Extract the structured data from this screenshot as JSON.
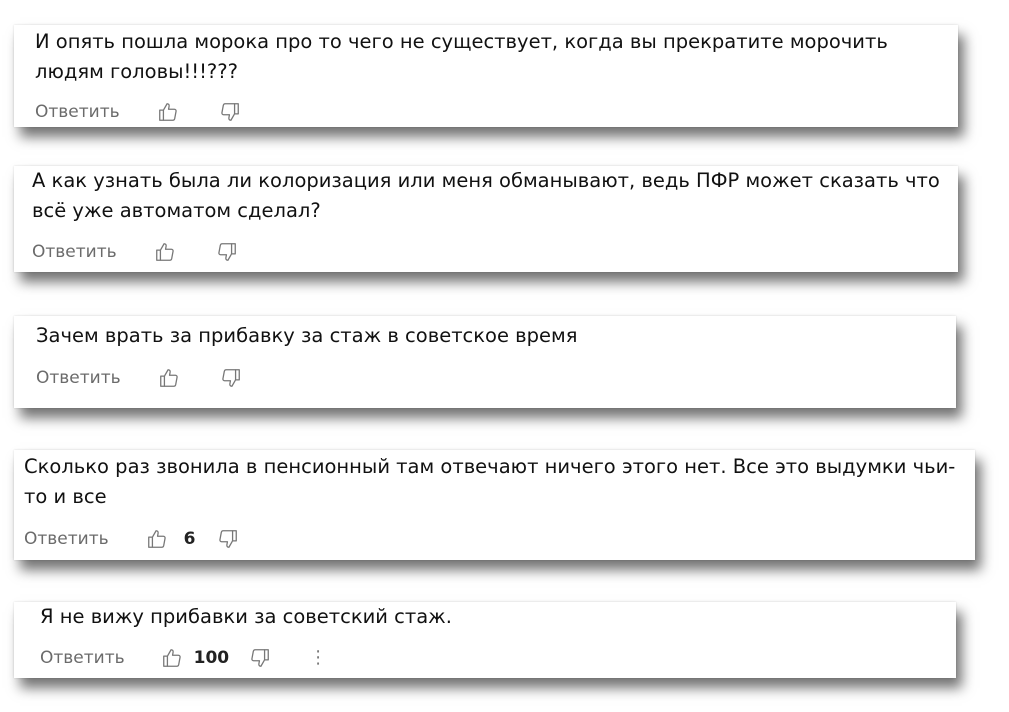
{
  "comments": [
    {
      "text": "И опять пошла морока про то чего не существует, когда вы прекратите морочить людям головы!!!???",
      "reply_label": "Ответить",
      "likes": ""
    },
    {
      "text": "А как узнать была ли колоризация или меня обманывают, ведь ПФР может сказать что всё уже автоматом сделал?",
      "reply_label": "Ответить",
      "likes": ""
    },
    {
      "text": "Зачем врать за прибавку за стаж в советское время",
      "reply_label": "Ответить",
      "likes": ""
    },
    {
      "text": "Сколько раз звонила в пенсионный там отвечают ничего этого нет. Все это выдумки чьи-то и все",
      "reply_label": "Ответить",
      "likes": "6"
    },
    {
      "text": "Я не вижу прибавки за советский стаж.",
      "reply_label": "Ответить",
      "likes": "100",
      "more_label": "⋮"
    }
  ],
  "icons": {
    "like": "thumbs-up-icon",
    "dislike": "thumbs-down-icon",
    "more": "more-options-icon"
  },
  "colors": {
    "text": "#111111",
    "muted": "#6b6b6b",
    "icon": "#777777"
  }
}
